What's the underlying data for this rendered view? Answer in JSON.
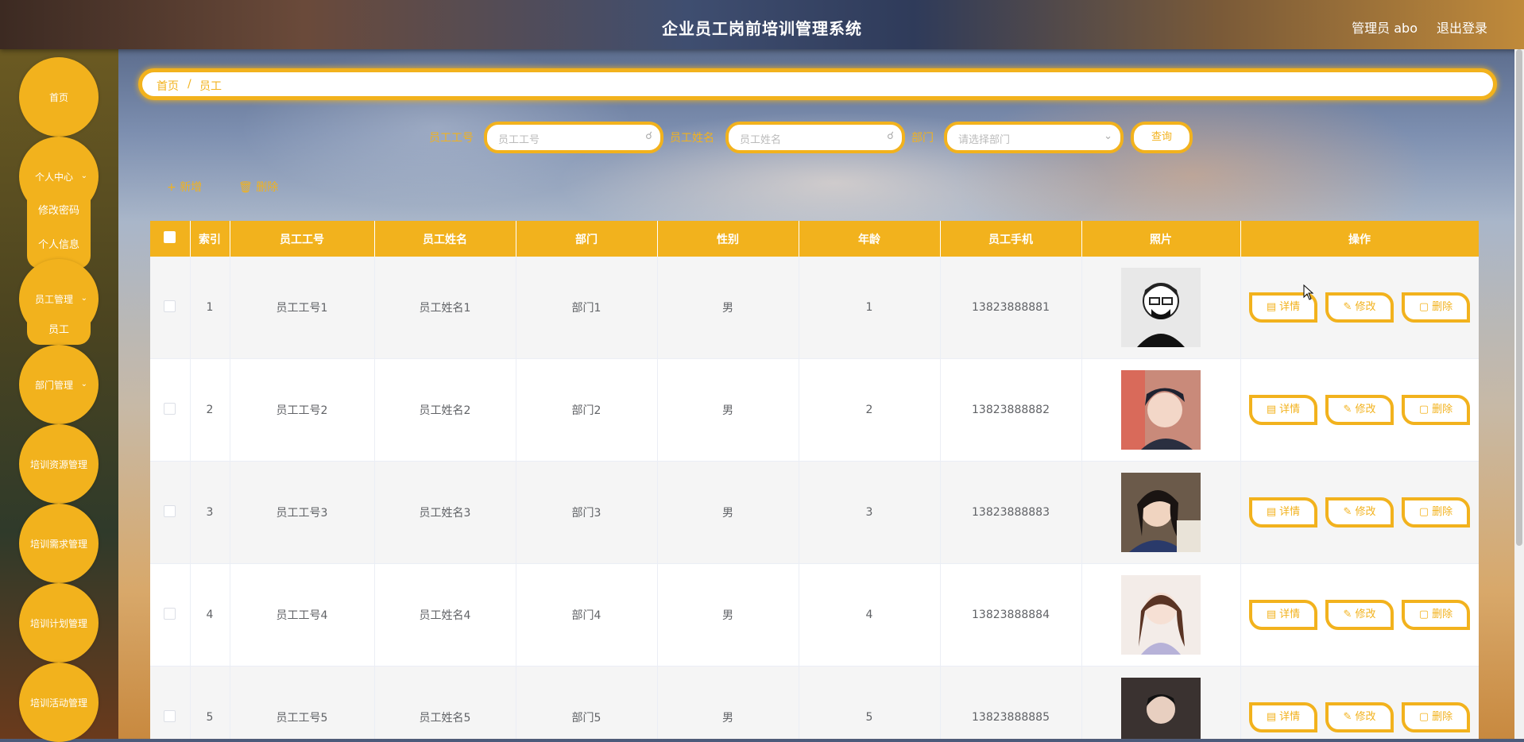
{
  "header": {
    "title": "企业员工岗前培训管理系统",
    "user": "管理员 abo",
    "logout": "退出登录"
  },
  "sidebar": {
    "items": [
      {
        "label": "首页"
      },
      {
        "label": "个人中心",
        "children": [
          "修改密码",
          "个人信息"
        ]
      },
      {
        "label": "员工管理",
        "children": [
          "员工"
        ]
      },
      {
        "label": "部门管理"
      },
      {
        "label": "培训资源管理"
      },
      {
        "label": "培训需求管理"
      },
      {
        "label": "培训计划管理"
      },
      {
        "label": "培训活动管理"
      }
    ]
  },
  "breadcrumb": {
    "home": "首页",
    "sep": "/",
    "current": "员工"
  },
  "search": {
    "no_label": "员工工号",
    "no_placeholder": "员工工号",
    "name_label": "员工姓名",
    "name_placeholder": "员工姓名",
    "dept_label": "部门",
    "dept_placeholder": "请选择部门",
    "query_button": "查询"
  },
  "toolbar": {
    "add": "新增",
    "delete": "删除"
  },
  "table": {
    "headers": [
      "索引",
      "员工工号",
      "员工姓名",
      "部门",
      "性别",
      "年龄",
      "员工手机",
      "照片",
      "操作"
    ],
    "rows": [
      {
        "index": "1",
        "no": "员工工号1",
        "name": "员工姓名1",
        "dept": "部门1",
        "gender": "男",
        "age": "1",
        "phone": "13823888881"
      },
      {
        "index": "2",
        "no": "员工工号2",
        "name": "员工姓名2",
        "dept": "部门2",
        "gender": "男",
        "age": "2",
        "phone": "13823888882"
      },
      {
        "index": "3",
        "no": "员工工号3",
        "name": "员工姓名3",
        "dept": "部门3",
        "gender": "男",
        "age": "3",
        "phone": "13823888883"
      },
      {
        "index": "4",
        "no": "员工工号4",
        "name": "员工姓名4",
        "dept": "部门4",
        "gender": "男",
        "age": "4",
        "phone": "13823888884"
      },
      {
        "index": "5",
        "no": "员工工号5",
        "name": "员工姓名5",
        "dept": "部门5",
        "gender": "男",
        "age": "5",
        "phone": "13823888885"
      }
    ],
    "ops": {
      "detail": "详情",
      "edit": "修改",
      "delete": "删除"
    }
  },
  "colors": {
    "accent": "#f2b21d"
  }
}
